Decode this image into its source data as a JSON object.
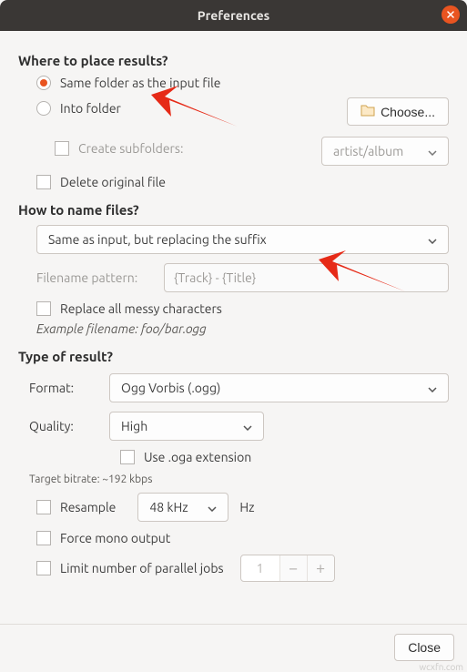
{
  "window": {
    "title": "Preferences"
  },
  "sections": {
    "place": {
      "heading": "Where to place results?",
      "same_folder": "Same folder as the input file",
      "into_folder": "Into folder",
      "choose": "Choose...",
      "create_subfolders": "Create subfolders:",
      "subfolder_template": "artist/album",
      "delete_original": "Delete original file"
    },
    "naming": {
      "heading": "How to name files?",
      "mode": "Same as input, but replacing the suffix",
      "pattern_label": "Filename pattern:",
      "pattern_placeholder": "{Track} - {Title}",
      "replace_messy": "Replace all messy characters",
      "example_label": "Example filename: ",
      "example_value": "foo/bar.ogg"
    },
    "type": {
      "heading": "Type of result?",
      "format_label": "Format:",
      "format_value": "Ogg Vorbis (.ogg)",
      "quality_label": "Quality:",
      "quality_value": "High",
      "oga_ext": "Use .oga extension",
      "target_bitrate": "Target bitrate: ~192 kbps",
      "resample": "Resample",
      "resample_value": "48 kHz",
      "hz": "Hz",
      "force_mono": "Force mono output",
      "limit_jobs": "Limit number of parallel jobs",
      "jobs_value": "1"
    }
  },
  "footer": {
    "close": "Close"
  }
}
